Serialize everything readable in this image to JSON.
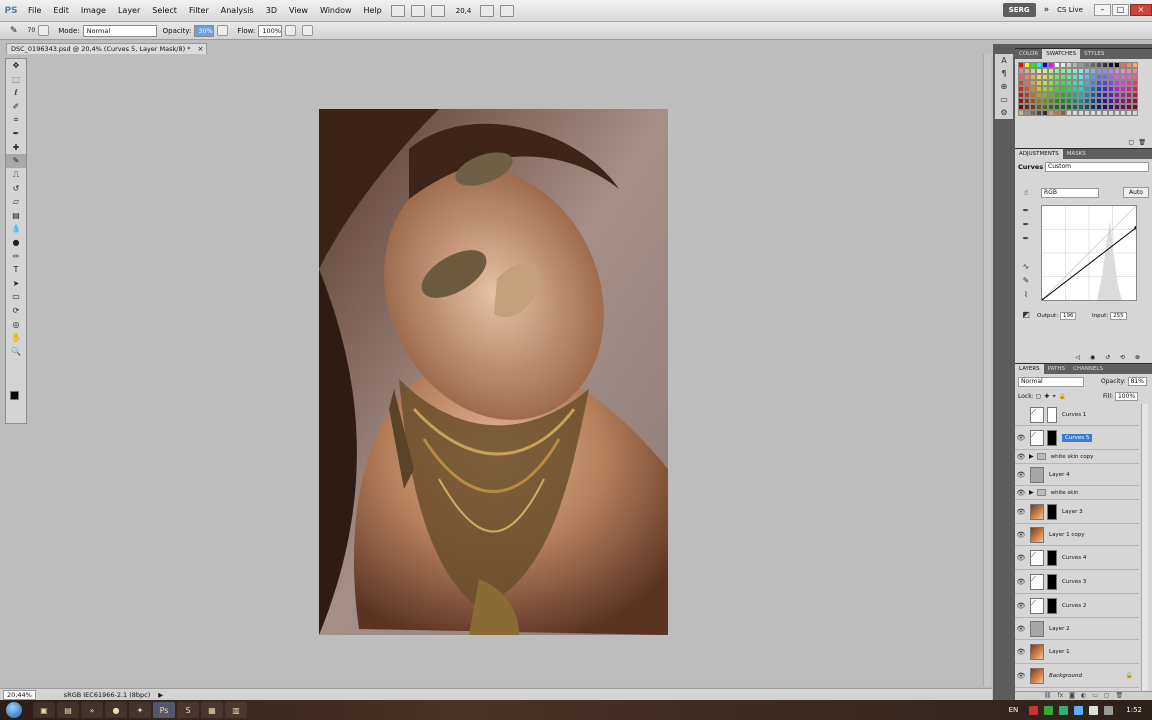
{
  "app": {
    "logo": "PS"
  },
  "menu": [
    "File",
    "Edit",
    "Image",
    "Layer",
    "Select",
    "Filter",
    "Analysis",
    "3D",
    "View",
    "Window",
    "Help"
  ],
  "menubar": {
    "zoom": "20,4",
    "workspace": "SERG",
    "cs_live": "CS Live"
  },
  "options": {
    "brush_size": "70",
    "mode_label": "Mode:",
    "mode_value": "Normal",
    "opacity_label": "Opacity:",
    "opacity_value": "30%",
    "flow_label": "Flow:",
    "flow_value": "100%"
  },
  "document": {
    "tab_title": "DSC_0196343.psd @ 20,4% (Curves 5, Layer Mask/8) *",
    "close": "×"
  },
  "status": {
    "zoom": "20,44%",
    "profile": "sRGB IEC61966-2.1 (8bpc)"
  },
  "tools": [
    "move",
    "marquee",
    "lasso",
    "quick-select",
    "crop",
    "eyedropper",
    "spot-heal",
    "brush",
    "clone-stamp",
    "history-brush",
    "eraser",
    "gradient",
    "blur",
    "dodge",
    "pen",
    "type",
    "path-select",
    "shape",
    "3d-rotate",
    "3d-orbit",
    "hand",
    "zoom"
  ],
  "swatch_panel": {
    "tabs": [
      "COLOR",
      "SWATCHES",
      "STYLES"
    ],
    "active_tab": 1
  },
  "adjustments": {
    "tabs": [
      "ADJUSTMENTS",
      "MASKS"
    ],
    "title": "Curves",
    "preset": "Custom",
    "channel": "RGB",
    "auto": "Auto",
    "output_label": "Output:",
    "output_value": "196",
    "input_label": "Input:",
    "input_value": "255",
    "curve_points": [
      [
        0,
        0
      ],
      [
        255,
        196
      ]
    ]
  },
  "layers_panel": {
    "tabs": [
      "LAYERS",
      "PATHS",
      "CHANNELS"
    ],
    "blend_mode": "Normal",
    "opacity_label": "Opacity:",
    "opacity_value": "81%",
    "lock_label": "Lock:",
    "fill_label": "Fill:",
    "fill_value": "100%",
    "layers": [
      {
        "name": "Curves 1",
        "kind": "adjustment",
        "mask": "white",
        "visible": false
      },
      {
        "name": "Curves 5",
        "kind": "adjustment",
        "mask": "black",
        "visible": true,
        "selected": true
      },
      {
        "name": "white skin copy",
        "kind": "group",
        "visible": true
      },
      {
        "name": "Layer 4",
        "kind": "grey",
        "visible": true
      },
      {
        "name": "white skin",
        "kind": "group",
        "visible": true
      },
      {
        "name": "Layer 3",
        "kind": "photo",
        "mask": "black",
        "visible": true
      },
      {
        "name": "Layer 1 copy",
        "kind": "photo",
        "visible": true
      },
      {
        "name": "Curves 4",
        "kind": "adjustment",
        "mask": "black",
        "visible": true
      },
      {
        "name": "Curves 3",
        "kind": "adjustment",
        "mask": "black",
        "visible": true
      },
      {
        "name": "Curves 2",
        "kind": "adjustment",
        "mask": "black",
        "visible": true
      },
      {
        "name": "Layer 2",
        "kind": "grey",
        "visible": true
      },
      {
        "name": "Layer 1",
        "kind": "photo",
        "visible": true
      },
      {
        "name": "Background",
        "kind": "photo",
        "visible": true,
        "locked": true
      }
    ]
  },
  "taskbar": {
    "lang": "EN",
    "time": "1:52"
  }
}
